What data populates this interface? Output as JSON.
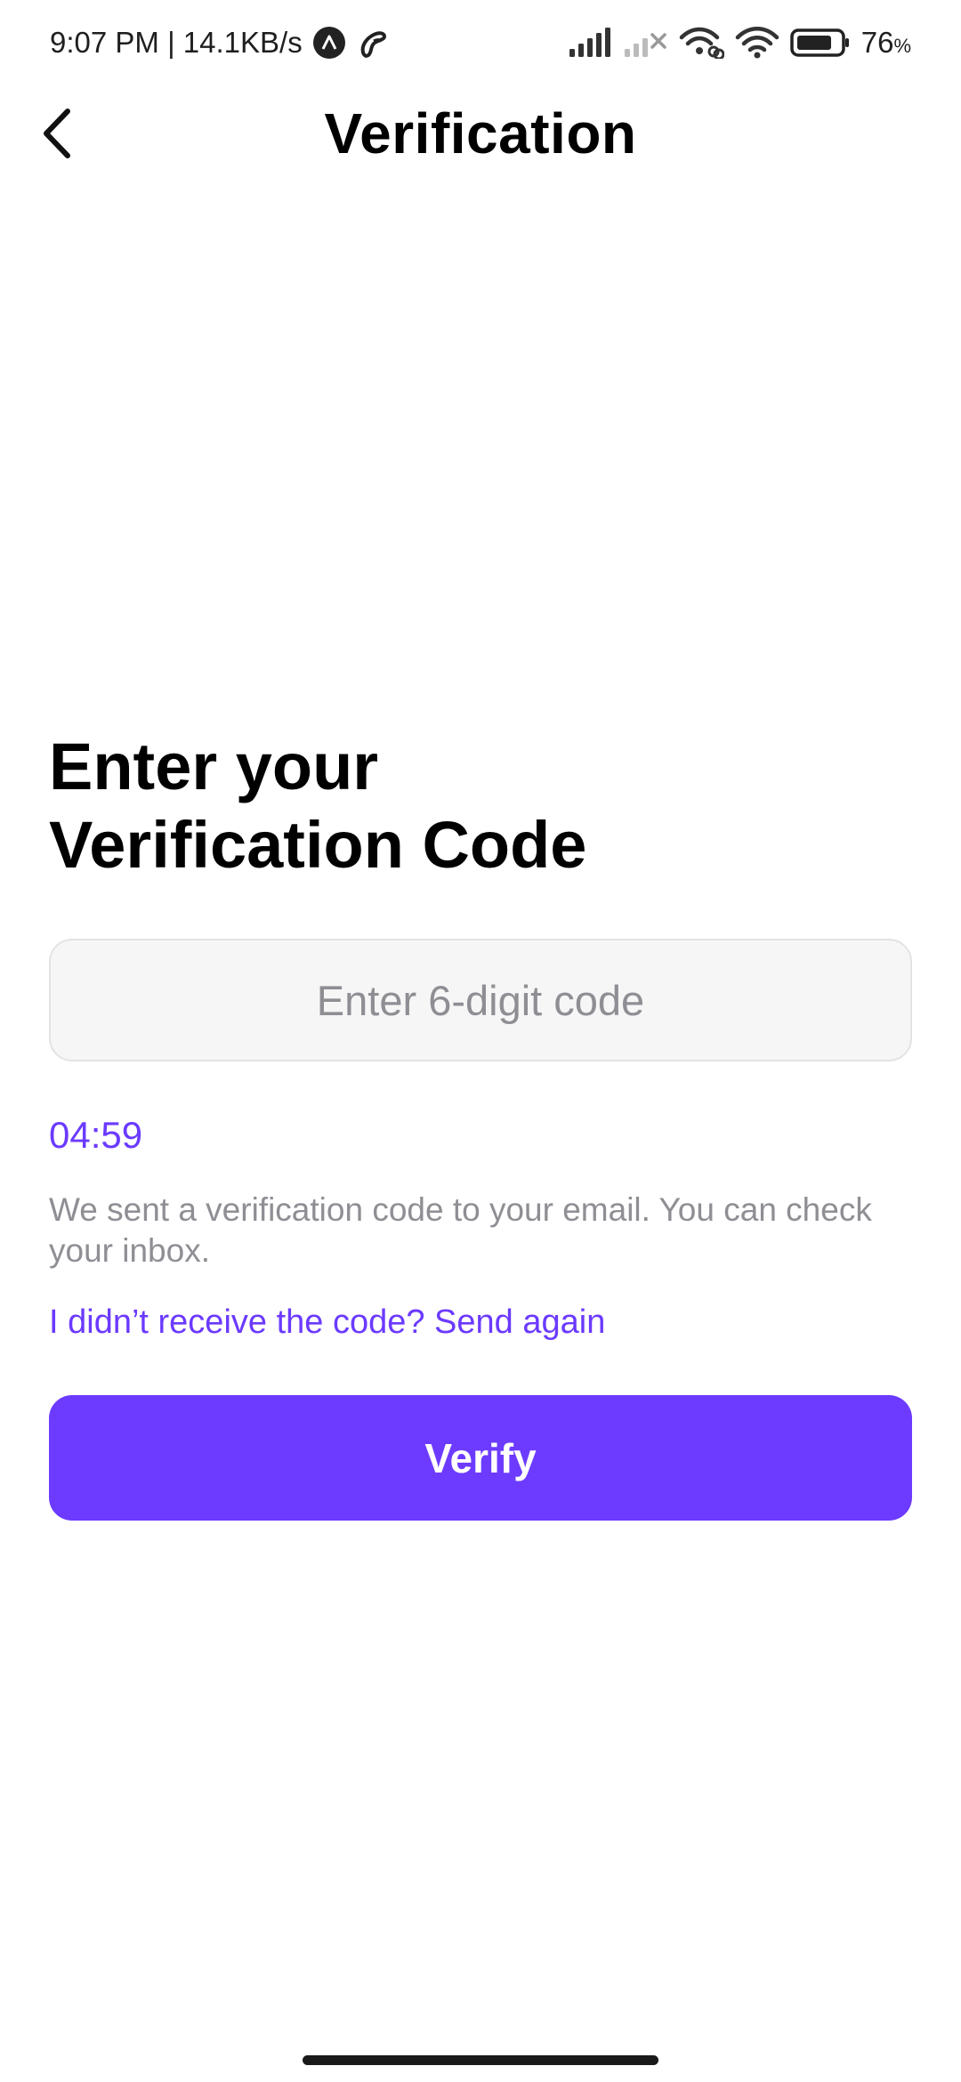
{
  "status_bar": {
    "time_speed": "9:07 PM | 14.1KB/s",
    "battery_percent": "76",
    "battery_unit": "%",
    "icons": [
      "app-a-icon",
      "phone-app-icon",
      "cell-signal-icon",
      "cell-signal-off-icon",
      "wifi-link-icon",
      "wifi-icon",
      "battery-icon"
    ]
  },
  "header": {
    "title": "Verification",
    "back_icon": "chevron-left-icon"
  },
  "main": {
    "heading_line1": "Enter your",
    "heading_line2": "Verification Code",
    "code_input": {
      "placeholder": "Enter 6-digit code",
      "value": ""
    },
    "timer": "04:59",
    "info_text": "We sent a verification code to your email. You can check your inbox.",
    "resend_link": "I didn’t receive the code? Send again",
    "verify_label": "Verify"
  },
  "colors": {
    "accent": "#6c3bff",
    "link": "#6b3aff",
    "muted_text": "#8e8e94",
    "input_bg": "#f6f6f6",
    "input_border": "#e3e3e6"
  }
}
